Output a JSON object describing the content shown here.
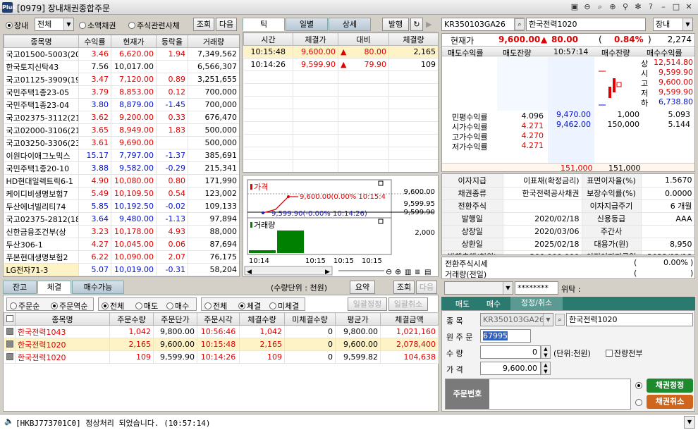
{
  "window": {
    "title": "[0979] 장내채권종합주문",
    "logo": "Plus"
  },
  "left": {
    "radio_jangnae": "장내",
    "market_select": "전체",
    "radio_small": "소액채권",
    "radio_stock": "주식관련사채",
    "btn_query": "조회",
    "btn_next": "다음",
    "headers": [
      "종목명",
      "수익률",
      "현재가",
      "등락율",
      "거래량"
    ],
    "rows": [
      {
        "name": "국고01500-5003(20",
        "yield": "3.46",
        "price": "6,620.00",
        "chg": "1.94",
        "vol": "7,349,562",
        "c": "red"
      },
      {
        "name": "한국토지신탁43",
        "yield": "7.56",
        "price": "10,017.00",
        "chg": "",
        "vol": "6,566,307",
        "c": ""
      },
      {
        "name": "국고01125-3909(19",
        "yield": "3.47",
        "price": "7,120.00",
        "chg": "0.89",
        "vol": "3,251,655",
        "c": "red"
      },
      {
        "name": "국민주택1종23-05",
        "yield": "3.79",
        "price": "8,853.00",
        "chg": "0.12",
        "vol": "700,000",
        "c": "red"
      },
      {
        "name": "국민주택1종23-04",
        "yield": "3.80",
        "price": "8,879.00",
        "chg": "-1.45",
        "vol": "700,000",
        "c": "blue"
      },
      {
        "name": "국고02375-3112(21",
        "yield": "3.62",
        "price": "9,200.00",
        "chg": "0.33",
        "vol": "676,470",
        "c": "red"
      },
      {
        "name": "국고02000-3106(21",
        "yield": "3.65",
        "price": "8,949.00",
        "chg": "1.83",
        "vol": "500,000",
        "c": "red"
      },
      {
        "name": "국고03250-3306(23",
        "yield": "3.61",
        "price": "9,690.00",
        "chg": "",
        "vol": "500,000",
        "c": "red"
      },
      {
        "name": "이원다이애그노믹스",
        "yield": "15.17",
        "price": "7,797.00",
        "chg": "-1.37",
        "vol": "385,691",
        "c": "blue"
      },
      {
        "name": "국민주택1종20-10",
        "yield": "3.88",
        "price": "9,582.00",
        "chg": "-0.29",
        "vol": "215,341",
        "c": "blue"
      },
      {
        "name": "HD현대일렉트릭6-1",
        "yield": "4.90",
        "price": "10,080.00",
        "chg": "0.80",
        "vol": "171,990",
        "c": "red"
      },
      {
        "name": "케이디비생명보험7",
        "yield": "5.49",
        "price": "10,109.50",
        "chg": "0.54",
        "vol": "123,002",
        "c": "red"
      },
      {
        "name": "두산에너빌리티74",
        "yield": "5.85",
        "price": "10,192.50",
        "chg": "-0.02",
        "vol": "109,133",
        "c": "blue"
      },
      {
        "name": "국고02375-2812(18",
        "yield": "3.64",
        "price": "9,480.00",
        "chg": "-1.13",
        "vol": "97,894",
        "c": "blue"
      },
      {
        "name": "신한금융조건부(상",
        "yield": "3.23",
        "price": "10,178.00",
        "chg": "4.93",
        "vol": "88,000",
        "c": "red"
      },
      {
        "name": "두산306-1",
        "yield": "4.27",
        "price": "10,045.00",
        "chg": "0.06",
        "vol": "87,694",
        "c": "red"
      },
      {
        "name": "푸본현대생명보험2",
        "yield": "6.22",
        "price": "10,090.00",
        "chg": "2.07",
        "vol": "76,175",
        "c": "red"
      },
      {
        "name": "LG전자71-3",
        "yield": "5.07",
        "price": "10,019.00",
        "chg": "-0.31",
        "vol": "58,204",
        "c": "blue"
      }
    ]
  },
  "tick": {
    "tabs": [
      "틱",
      "일별",
      "상세"
    ],
    "btn_issue": "발행",
    "headers": [
      "시간",
      "체결가",
      "대비",
      "체결량"
    ],
    "rows": [
      {
        "time": "10:15:48",
        "price": "9,600.00",
        "arrow": "▲",
        "diff": "80.00",
        "qty": "2,165"
      },
      {
        "time": "10:14:26",
        "price": "9,599.90",
        "arrow": "▲",
        "diff": "79.90",
        "qty": "109"
      }
    ]
  },
  "mini_chart": {
    "price_label": "가격",
    "volume_label": "거래량",
    "note_high": "9,600.00(0.00% 10:15:4",
    "note_low": "9,599.90(-0.00% 10:14:26)",
    "yticks": [
      "9,600.00",
      "9,599.95",
      "9,599.90"
    ],
    "vol_tick": "2,000",
    "xticks": [
      "10:14",
      "10:15",
      "10:15",
      "10:15"
    ],
    "price_colors": {
      "line": "#e00000",
      "low": "#2020c0"
    }
  },
  "quote": {
    "code": "KR350103GA26",
    "name": "한국전력1020",
    "market": "장내",
    "cur_label": "현재가",
    "cur_price": "9,600.00",
    "arrow": "▲",
    "diff": "80.00",
    "pct_open": "(",
    "pct": "0.84%",
    "pct_close": ")",
    "volume": "2,274",
    "hdr": [
      "매도수익률",
      "매도잔량",
      "10:57:14",
      "매수잔량",
      "매수수익률"
    ],
    "side": [
      {
        "k": "상",
        "v": "12,514.80"
      },
      {
        "k": "시",
        "v": "9,599.90"
      },
      {
        "k": "고",
        "v": "9,600.00"
      },
      {
        "k": "저",
        "v": "9,599.90"
      },
      {
        "k": "하",
        "v": "6,738.80"
      }
    ],
    "yields": [
      {
        "k": "민평수익률",
        "v": "4.096"
      },
      {
        "k": "시가수익률",
        "v": "4.271"
      },
      {
        "k": "고가수익률",
        "v": "4.270"
      },
      {
        "k": "저가수익률",
        "v": "4.271"
      }
    ],
    "bids": [
      {
        "price": "9,470.00",
        "qty": "1,000",
        "yield": "5.093"
      },
      {
        "price": "9,462.00",
        "qty": "150,000",
        "yield": "5.144"
      }
    ],
    "total_ask": "151,000",
    "total_bid": "151,000"
  },
  "info": {
    "rows": [
      [
        "이자지급",
        "이표채(확정금리)",
        "표면이자율(%)",
        "1.5670"
      ],
      [
        "채권종류",
        "한국전력공사채권",
        "보장수익률(%)",
        "0.0000"
      ],
      [
        "전환주식",
        "",
        "이자지급주기",
        "6 개월"
      ],
      [
        "발행일",
        "2020/02/18",
        "신용등급",
        "AAA"
      ],
      [
        "상장일",
        "2020/03/06",
        "주간사",
        ""
      ],
      [
        "상환일",
        "2025/02/18",
        "대용가(원)",
        "8,950"
      ],
      [
        "발행총액(천원)",
        "200,000,000",
        "이전이자지급일",
        "2023/02/18"
      ]
    ],
    "conv_label": "전환주식시세",
    "conv_open": "(",
    "conv_val": "0.00%",
    "conv_close": ")",
    "prevvol_label": "거래량(전일)",
    "prevvol_open": "(",
    "prevvol_close": ")"
  },
  "bottom": {
    "tabs": [
      "잔고",
      "체결",
      "매수가능"
    ],
    "unit": "(수량단위 : 천원)",
    "btn_summary": "요약",
    "btn_query": "조회",
    "btn_next": "다음",
    "radios1": [
      "주문순",
      "주문역순"
    ],
    "radios2": [
      "전체",
      "매도",
      "매수"
    ],
    "radios3": [
      "전체",
      "체결",
      "미체결"
    ],
    "btn_bulk_mod": "일괄정정",
    "btn_bulk_cancel": "일괄취소",
    "headers": [
      "종목명",
      "주문수량",
      "주문단가",
      "주문시각",
      "체결수량",
      "미체결수량",
      "평균가",
      "체결금액"
    ],
    "rows": [
      {
        "name": "한국전력1043",
        "oq": "1,042",
        "op": "9,800.00",
        "ot": "10:56:46",
        "fq": "1,042",
        "uq": "0",
        "avg": "9,800.00",
        "amt": "1,021,160"
      },
      {
        "name": "한국전력1020",
        "oq": "2,165",
        "op": "9,600.00",
        "ot": "10:15:48",
        "fq": "2,165",
        "uq": "0",
        "avg": "9,600.00",
        "amt": "2,078,400"
      },
      {
        "name": "한국전력1020",
        "oq": "109",
        "op": "9,599.90",
        "ot": "10:14:26",
        "fq": "109",
        "uq": "0",
        "avg": "9,599.82",
        "amt": "104,638"
      }
    ]
  },
  "order": {
    "password": "********",
    "consign": "위탁 :",
    "tabs": [
      "매도",
      "매수",
      "정정/취소"
    ],
    "lbl_code": "종     목",
    "code": "KR350103GA26",
    "name": "한국전력1020",
    "lbl_orig": "원 주 문",
    "orig": "67995",
    "lbl_qty": "수       량",
    "qty": "0",
    "unit": "(단위:천원)",
    "all_remaining": "잔량전부",
    "lbl_price": "가       격",
    "price": "9,600.00",
    "order_no": "주문번호",
    "btn_modify": "채권정정",
    "btn_cancel": "채권취소"
  },
  "status": {
    "msg": "[HKBJ773701C0] 정상처리 되었습니다. (10:57:14)"
  }
}
